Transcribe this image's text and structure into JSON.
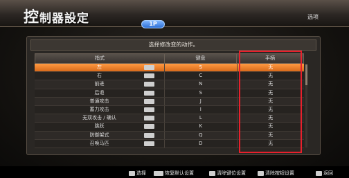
{
  "header": {
    "title_first": "控",
    "title_rest": "制器設定",
    "badge": "1P",
    "right_label": "选项"
  },
  "prompt": "选择修改变的动作。",
  "columns": [
    "指式",
    "键盘",
    "手柄"
  ],
  "rows": [
    {
      "action": "左",
      "key": "S",
      "pad": "无",
      "selected": true
    },
    {
      "action": "右",
      "key": "C",
      "pad": "无"
    },
    {
      "action": "前进",
      "key": "N",
      "pad": "无"
    },
    {
      "action": "后退",
      "key": "S",
      "pad": "无"
    },
    {
      "action": "普通攻击",
      "key": "J",
      "pad": "无"
    },
    {
      "action": "蓄力攻击",
      "key": "I",
      "pad": "无"
    },
    {
      "action": "无双攻击 / 确认",
      "key": "L",
      "pad": "无"
    },
    {
      "action": "跳跃",
      "key": "K",
      "pad": "无"
    },
    {
      "action": "防御架式",
      "key": "Q",
      "pad": "无"
    },
    {
      "action": "召唤马匹",
      "key": "D",
      "pad": "无"
    }
  ],
  "footer": {
    "hint1": "选择",
    "hint2": "恢复默认设置",
    "hint3": "清除键位设置",
    "hint4": "清除按钮设置",
    "hint5": "返回"
  },
  "colors": {
    "selected": "#e87a25",
    "highlight": "#e8202c",
    "badge": "#2d6fd6"
  }
}
